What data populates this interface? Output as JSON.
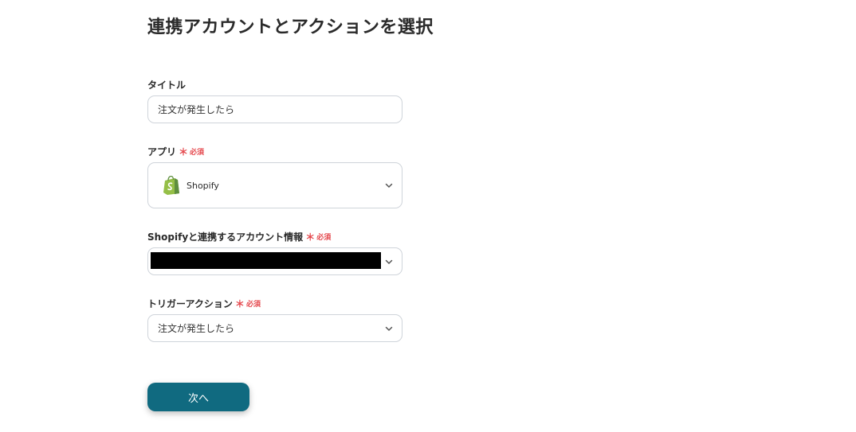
{
  "header": {
    "title": "連携アカウントとアクションを選択"
  },
  "form": {
    "title_field": {
      "label": "タイトル",
      "value": "注文が発生したら"
    },
    "app_field": {
      "label": "アプリ",
      "required_mark": "＊",
      "required_text": "必須",
      "value": "Shopify"
    },
    "account_field": {
      "label": "Shopifyと連携するアカウント情報",
      "required_mark": "＊",
      "required_text": "必須"
    },
    "trigger_field": {
      "label": "トリガーアクション",
      "required_mark": "＊",
      "required_text": "必須",
      "value": "注文が発生したら"
    }
  },
  "actions": {
    "next_label": "次へ"
  },
  "colors": {
    "primary_button": "#106a80",
    "required": "#e5484d",
    "shopify_green": "#95bf47"
  },
  "icons": {
    "app_logo": "shopify-icon",
    "dropdown": "chevron-down-icon"
  }
}
